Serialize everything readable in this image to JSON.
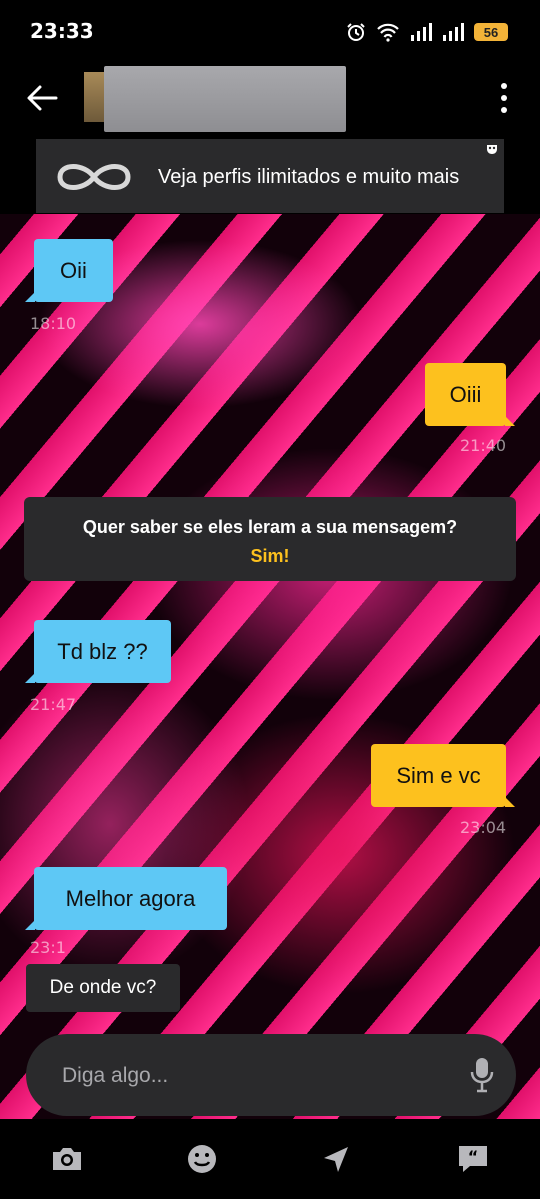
{
  "status_bar": {
    "time": "23:33",
    "battery": "56"
  },
  "header": {
    "back_icon": "arrow-left-icon",
    "menu_icon": "more-vertical-icon"
  },
  "promo": {
    "text": "Veja perfis ilimitados e muito mais",
    "icon": "infinity-icon",
    "corner_icon": "grindr-mask-icon"
  },
  "messages": [
    {
      "direction": "in",
      "text": "Oii",
      "time": "18:10"
    },
    {
      "direction": "out",
      "text": "Oiii",
      "time": "21:40"
    },
    {
      "direction": "in",
      "text": "Td blz ??",
      "time": "21:47"
    },
    {
      "direction": "out",
      "text": "Sim e vc",
      "time": "23:04"
    },
    {
      "direction": "in",
      "text": "Melhor agora",
      "time": "23:1"
    }
  ],
  "read_receipt_prompt": {
    "question": "Quer saber se eles leram a sua mensagem?",
    "action": "Sim!"
  },
  "quick_reply": {
    "text": "De onde vc?"
  },
  "composer": {
    "placeholder": "Diga algo..."
  },
  "toolbar": {
    "items": [
      "camera-icon",
      "emoji-icon",
      "location-arrow-icon",
      "saved-phrases-icon"
    ]
  },
  "colors": {
    "incoming_bubble": "#5ec8f5",
    "outgoing_bubble": "#fdc11e",
    "accent": "#fdc11e",
    "panel": "#2a2a2c"
  }
}
